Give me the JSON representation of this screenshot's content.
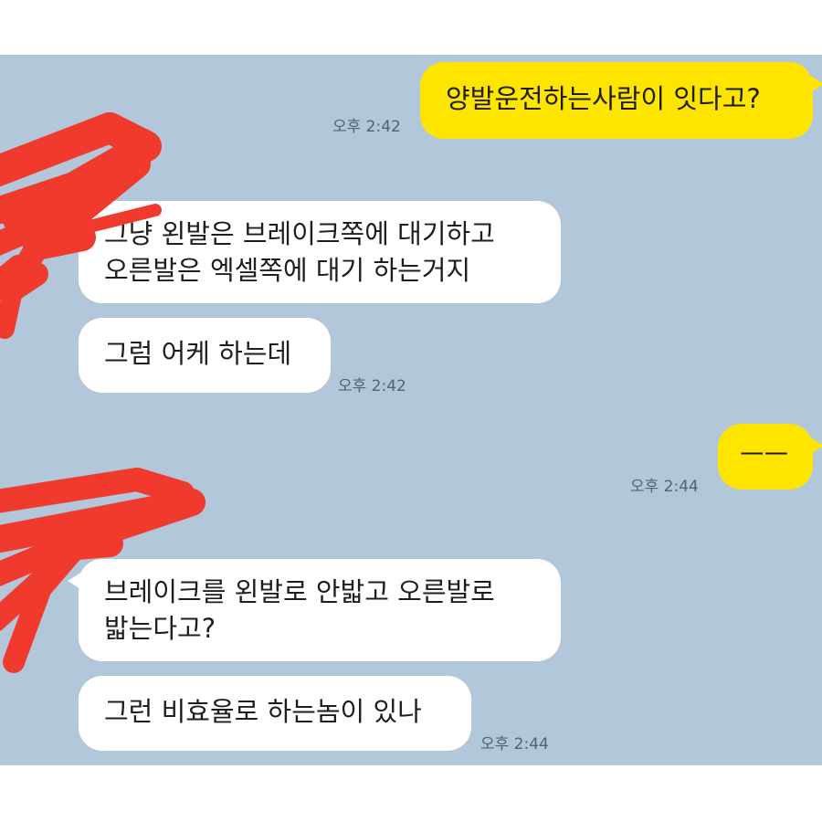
{
  "chat": {
    "messages": [
      {
        "sender": "me",
        "lines": [
          "양발운전하는사람이 잇다고?"
        ],
        "time": "오후 2:42"
      },
      {
        "sender": "them",
        "lines": [
          "그냥 왼발은 브레이크쪽에 대기하고",
          "오른발은 엑셀쪽에 대기 하는거지"
        ],
        "time": ""
      },
      {
        "sender": "them",
        "lines": [
          "그럼 어케 하는데"
        ],
        "time": "오후 2:42"
      },
      {
        "sender": "me",
        "lines": [
          "ㅡㅡ"
        ],
        "time": "오후 2:44"
      },
      {
        "sender": "them",
        "lines": [
          "브레이크를 왼발로 안밟고 오른발로",
          "밟는다고?"
        ],
        "time": ""
      },
      {
        "sender": "them",
        "lines": [
          "그런 비효율로 하는놈이 있나"
        ],
        "time": "오후 2:44"
      }
    ]
  },
  "colors": {
    "chat_background": "#b2c7da",
    "my_bubble": "#fee500",
    "their_bubble": "#ffffff",
    "redaction": "#f03a2e"
  },
  "icons": {
    "redaction_top": "red-scribble-redaction",
    "redaction_bottom": "red-scribble-redaction"
  }
}
